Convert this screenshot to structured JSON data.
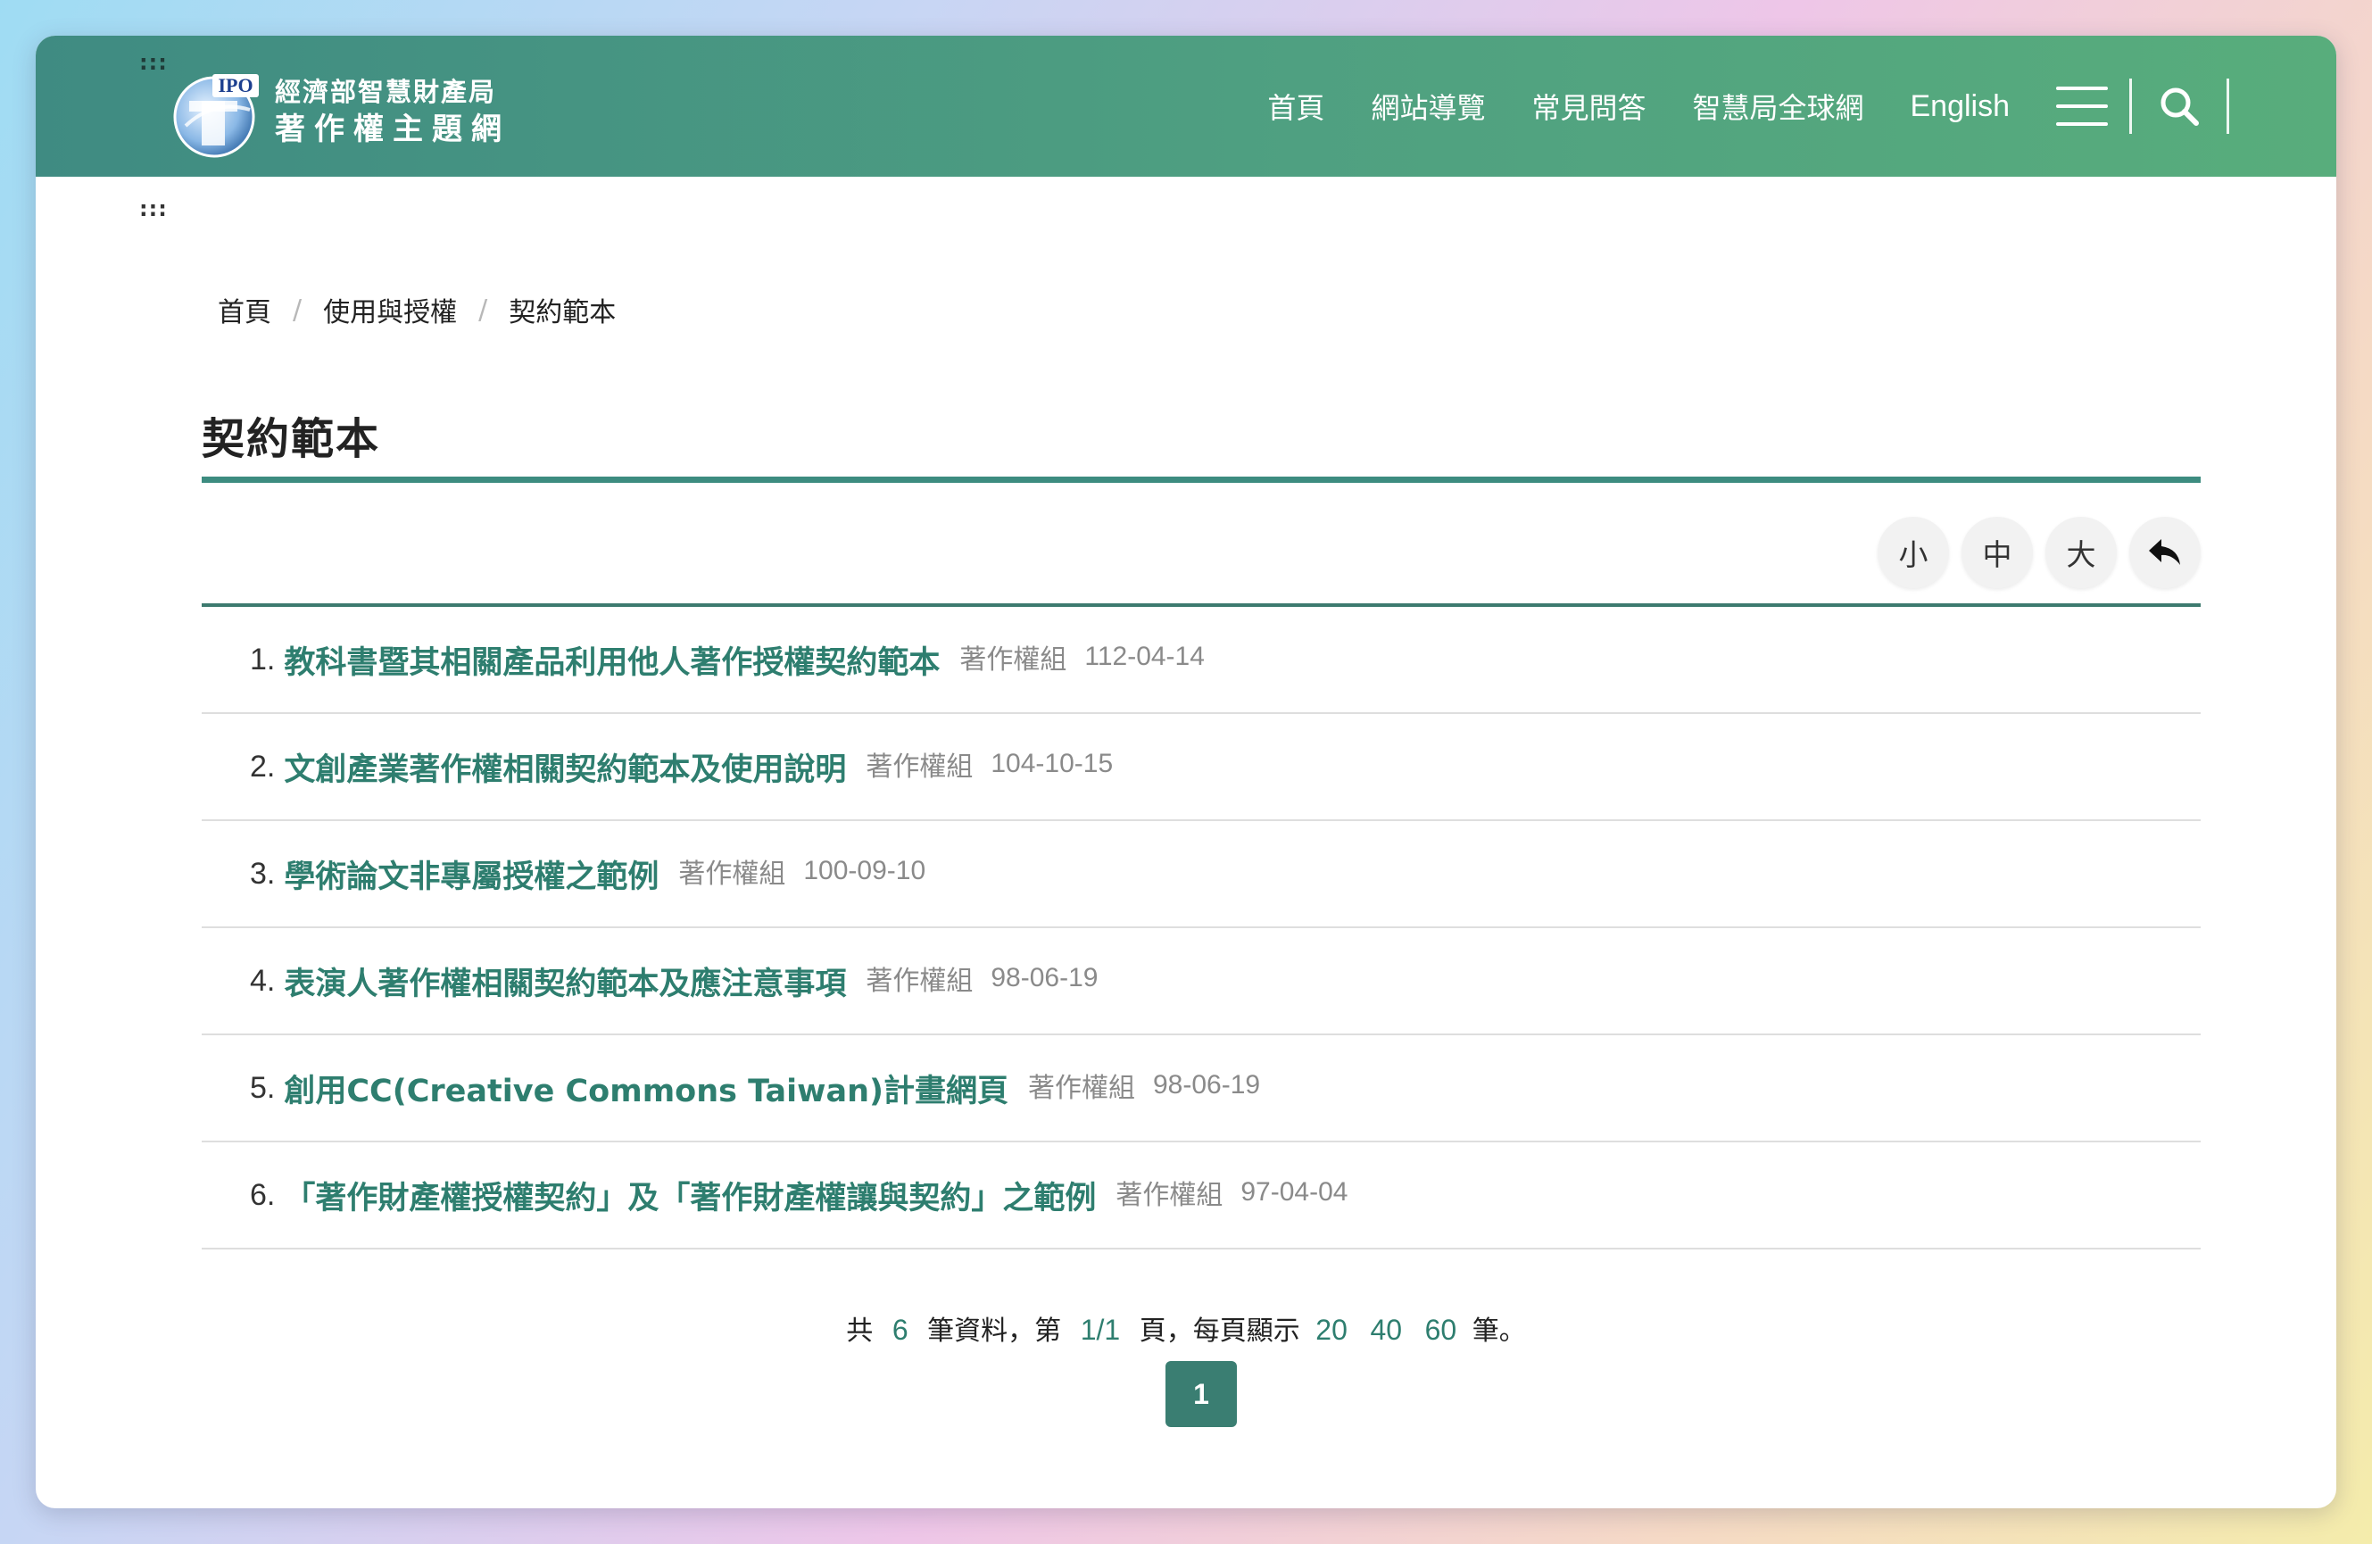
{
  "header": {
    "accesskey_top": ":::",
    "logo_line1": "經濟部智慧財產局",
    "logo_line2": "著作權主題網",
    "logo_mark_text": "IPO",
    "nav": [
      "首頁",
      "網站導覽",
      "常見問答",
      "智慧局全球網",
      "English"
    ],
    "menu_icon": "hamburger-icon",
    "search_icon": "search-icon"
  },
  "accesskey_main": ":::",
  "breadcrumb": [
    "首頁",
    "使用與授權",
    "契約範本"
  ],
  "breadcrumb_sep": "/",
  "page_title": "契約範本",
  "font_size_tools": [
    "小",
    "中",
    "大"
  ],
  "back_icon": "reply-arrow-icon",
  "items": [
    {
      "num": "1.",
      "title": "教科書暨其相關產品利用他人著作授權契約範本",
      "unit": "著作權組",
      "date": "112-04-14"
    },
    {
      "num": "2.",
      "title": "文創產業著作權相關契約範本及使用說明",
      "unit": "著作權組",
      "date": "104-10-15"
    },
    {
      "num": "3.",
      "title": "學術論文非專屬授權之範例",
      "unit": "著作權組",
      "date": "100-09-10"
    },
    {
      "num": "4.",
      "title": "表演人著作權相關契約範本及應注意事項",
      "unit": "著作權組",
      "date": "98-06-19"
    },
    {
      "num": "5.",
      "title": "創用CC(Creative Commons Taiwan)計畫網頁",
      "unit": "著作權組",
      "date": "98-06-19"
    },
    {
      "num": "6.",
      "title": "「著作財產權授權契約」及「著作財產權讓與契約」之範例",
      "unit": "著作權組",
      "date": "97-04-04"
    }
  ],
  "pager": {
    "prefix": "共",
    "total": "6",
    "mid1": "筆資料，第",
    "page_of": "1/1",
    "mid2": "頁，每頁顯示",
    "sizes": [
      "20",
      "40",
      "60"
    ],
    "suffix": "筆。",
    "current_page": "1"
  }
}
